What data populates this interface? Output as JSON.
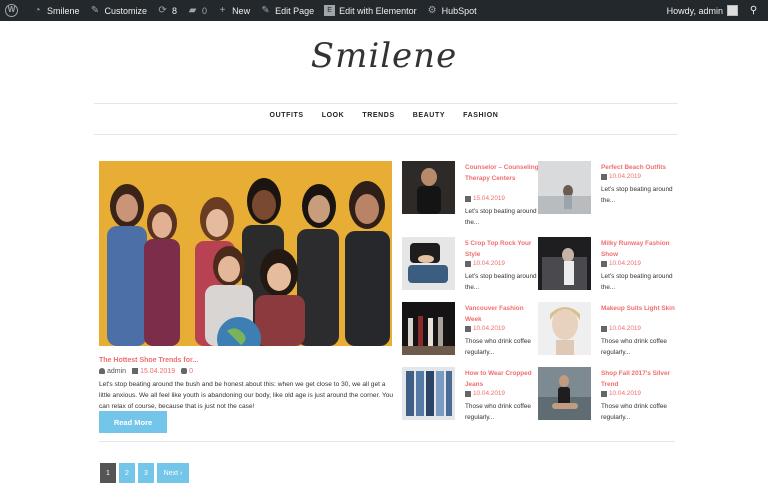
{
  "adminbar": {
    "site_name": "Smilene",
    "customize": "Customize",
    "updates_count": "8",
    "comments_count": "0",
    "new_label": "New",
    "edit_page": "Edit Page",
    "elementor": "Edit with Elementor",
    "hubspot": "HubSpot",
    "howdy": "Howdy, admin"
  },
  "site": {
    "logo": "Smilene"
  },
  "nav": [
    "OUTFITS",
    "LOOK",
    "TRENDS",
    "BEAUTY",
    "FASHION"
  ],
  "featured": {
    "title": "The Hottest Shoe Trends for...",
    "author": "admin",
    "date": "15.04.2019",
    "comments": "0",
    "excerpt": "Let's stop beating around the bush and be honest about this: when we get close to 30, we all get a little anxious. We all feel like youth is abandoning our body, like old age is just around the corner. You can relax of course, because that is just not the case!",
    "read_more": "Read More"
  },
  "posts": [
    {
      "title": "Counselor – Counseling Therapy Centers",
      "date": "15.04.2019",
      "excerpt": "Let's stop beating around the..."
    },
    {
      "title": "Perfect Beach Outfits",
      "date": "10.04.2019",
      "excerpt": "Let's stop beating around the..."
    },
    {
      "title": "5 Crop Top Rock Your Style",
      "date": "10.04.2019",
      "excerpt": "Let's stop beating around the..."
    },
    {
      "title": "Milky Runway Fashion Show",
      "date": "10.04.2019",
      "excerpt": "Let's stop beating around the..."
    },
    {
      "title": "Vancouver Fashion Week",
      "date": "10.04.2019",
      "excerpt": "Those who drink coffee regularly..."
    },
    {
      "title": "Makeup Suits Light Skin",
      "date": "10.04.2019",
      "excerpt": "Those who drink coffee regularly..."
    },
    {
      "title": "How to Wear Cropped Jeans",
      "date": "10.04.2019",
      "excerpt": "Those who drink coffee regularly..."
    },
    {
      "title": "Shop Fall 2017's Silver Trend",
      "date": "10.04.2019",
      "excerpt": "Those who drink coffee regularly..."
    }
  ],
  "pagination": {
    "pages": [
      "1",
      "2",
      "3"
    ],
    "next": "Next ›"
  },
  "colors": {
    "accent": "#f06e6e",
    "button": "#74c5ea",
    "adminbar": "#23282d"
  }
}
